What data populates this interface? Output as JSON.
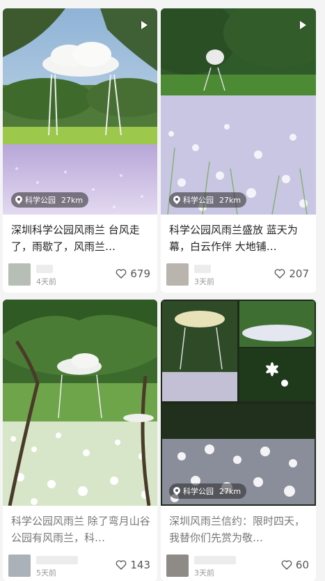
{
  "feed": [
    {
      "title": "深圳科学公园风雨兰 台风走了，雨歇了，风雨兰…",
      "location": "科学公园",
      "distance": "27km",
      "time": "4天前",
      "likes": "679",
      "is_video": true,
      "avatar_color": "#b6beb5"
    },
    {
      "title": "科学公园风雨兰盛放 蓝天为幕，白云作伴 大地铺…",
      "location": "科学公园",
      "distance": "27km",
      "time": "3天前",
      "likes": "207",
      "is_video": true,
      "avatar_color": "#b9b4ad"
    },
    {
      "title": "科学公园风雨兰 除了弯月山谷公园有风雨兰，科…",
      "location": "",
      "distance": "",
      "time": "5天前",
      "likes": "143",
      "is_video": false,
      "avatar_color": "#aab1b8"
    },
    {
      "title": "深圳风雨兰信约：限时四天，我替你们先赏为敬…",
      "location": "科学公园",
      "distance": "27km",
      "time": "3天前",
      "likes": "60",
      "is_video": false,
      "avatar_color": "#8e8a85"
    }
  ],
  "icons": {
    "location": "map-pin-icon",
    "like": "heart-outline-icon",
    "video": "play-icon"
  }
}
